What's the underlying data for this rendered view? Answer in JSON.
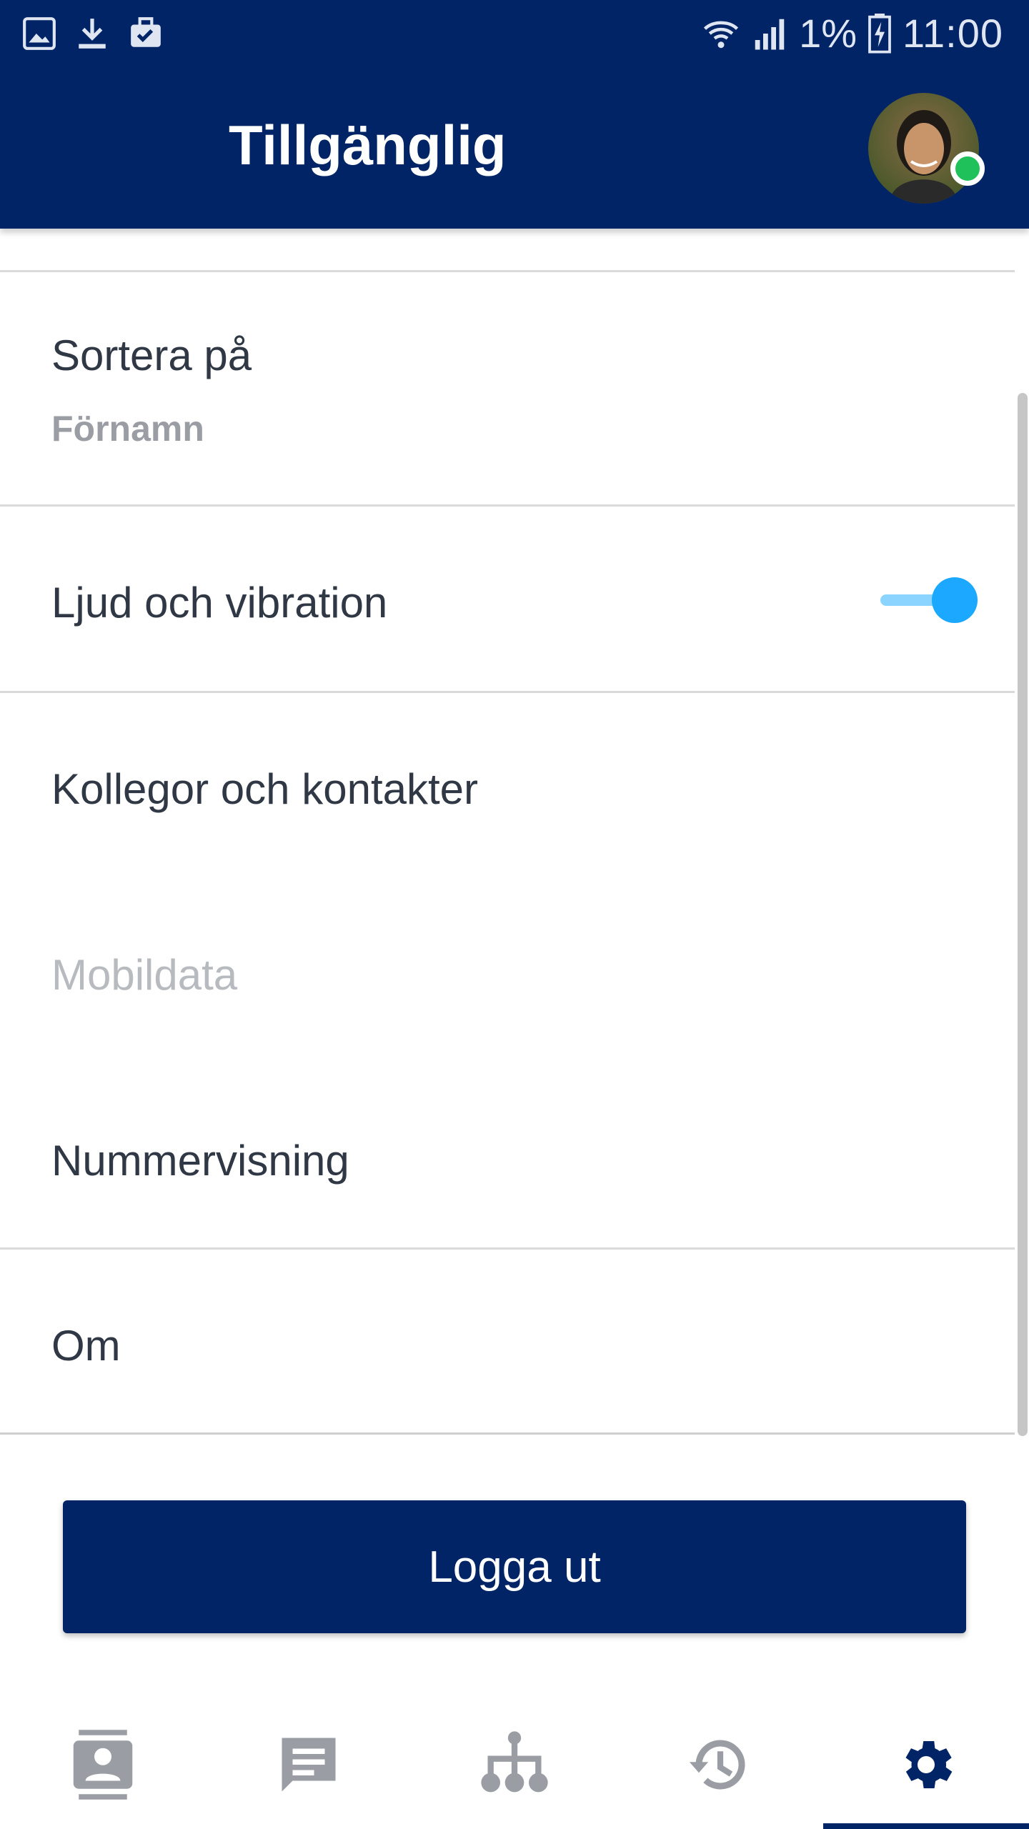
{
  "status_bar": {
    "left_icons": [
      "image-icon",
      "download-icon",
      "briefcase-check-icon"
    ],
    "signal_icons": [
      "wifi-icon",
      "cell-signal-icon"
    ],
    "battery_percent": "1%",
    "time": "11:00",
    "battery_icon": "battery-charging-icon"
  },
  "app_bar": {
    "title": "Tillgänglig",
    "presence_color": "#1fc25a"
  },
  "settings": {
    "sort": {
      "label": "Sortera på",
      "value": "Förnamn"
    },
    "sound": {
      "label": "Ljud och vibration",
      "enabled": true
    },
    "colleagues": {
      "label": "Kollegor och kontakter"
    },
    "mobile_data": {
      "label": "Mobildata",
      "disabled": true
    },
    "caller_id": {
      "label": "Nummervisning"
    },
    "about": {
      "label": "Om"
    }
  },
  "logout_button": {
    "label": "Logga ut"
  },
  "bottom_nav": {
    "items": [
      "contacts-icon",
      "chat-icon",
      "org-chart-icon",
      "history-icon",
      "settings-icon"
    ],
    "active": "settings-icon"
  },
  "colors": {
    "primary": "#002466",
    "toggle_accent": "#1ca8ff",
    "nav_icon": "#9a9da3"
  }
}
